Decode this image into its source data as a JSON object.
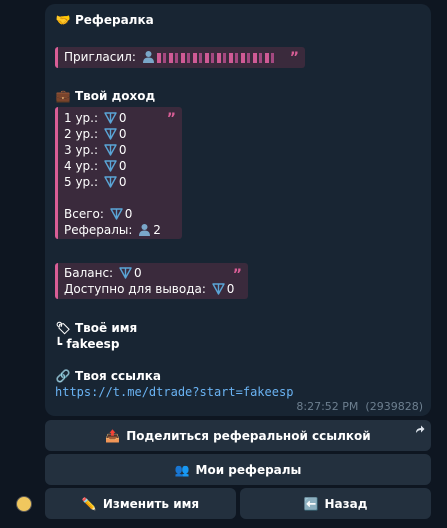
{
  "message": {
    "title_emoji": "🤝",
    "title": "Рефералка",
    "invited_label": "Пригласил:",
    "income_emoji": "💼",
    "income_title": "Твой доход",
    "levels": [
      {
        "label": "1 ур.:",
        "value": "0"
      },
      {
        "label": "2 ур.:",
        "value": "0"
      },
      {
        "label": "3 ур.:",
        "value": "0"
      },
      {
        "label": "4 ур.:",
        "value": "0"
      },
      {
        "label": "5 ур.:",
        "value": "0"
      }
    ],
    "total_label": "Всего:",
    "total_value": "0",
    "referrals_label": "Рефералы:",
    "referrals_value": "2",
    "balance_label": "Баланс:",
    "balance_value": "0",
    "withdraw_label": "Доступно для вывода:",
    "withdraw_value": "0",
    "name_emoji": "🏷",
    "name_title": "Твоё имя",
    "name_corner": "┗",
    "name_value": "fakeesp",
    "link_emoji": "🔗",
    "link_title": "Твоя ссылка",
    "link_url": "https://t.me/dtrade?start=fakeesp",
    "time": "8:27:52 PM",
    "msg_id": "(2939828)",
    "quote_mark": "”"
  },
  "keyboard": {
    "share_icon": "📤",
    "share_label": "Поделиться реферальной ссылкой",
    "my_refs_icon": "👥",
    "my_refs_label": "Мои рефералы",
    "rename_icon": "✏️",
    "rename_label": "Изменить имя",
    "back_icon": "⬅️",
    "back_label": "Назад"
  },
  "colors": {
    "background": "#0e1621",
    "bubble": "#182533",
    "quote_bg": "#3a2a3c",
    "quote_accent": "#d85e96",
    "link": "#6ab3f3",
    "button": "#23303e",
    "ton": "#5aa5d6"
  }
}
